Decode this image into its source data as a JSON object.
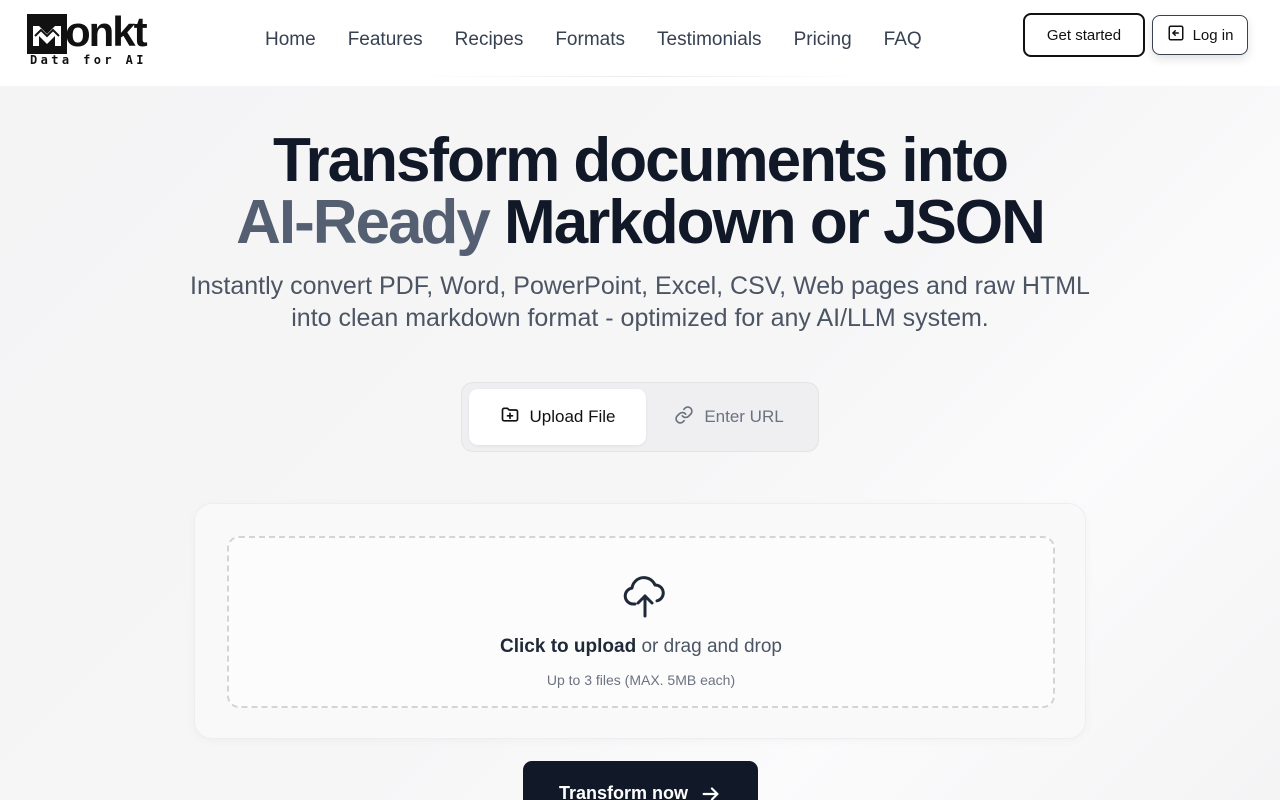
{
  "brand": {
    "name": "Monkt",
    "wordmark": "onkt",
    "tagline": "Data for AI"
  },
  "nav": {
    "items": [
      {
        "label": "Home"
      },
      {
        "label": "Features"
      },
      {
        "label": "Recipes"
      },
      {
        "label": "Formats"
      },
      {
        "label": "Testimonials"
      },
      {
        "label": "Pricing"
      },
      {
        "label": "FAQ"
      }
    ]
  },
  "header": {
    "get_started_label": "Get started",
    "login_label": "Log in"
  },
  "hero": {
    "title_line1": "Transform documents into",
    "title_accent": "AI-Ready",
    "title_line2_rest": "Markdown or JSON",
    "subtitle_line1": "Instantly convert PDF, Word, PowerPoint, Excel, CSV, Web pages and raw HTML",
    "subtitle_line2": "into clean markdown format - optimized for any AI/LLM system."
  },
  "tabs": [
    {
      "label": "Upload File",
      "icon": "folder-plus-icon",
      "active": true
    },
    {
      "label": "Enter URL",
      "icon": "link-icon",
      "active": false
    }
  ],
  "upload": {
    "icon": "cloud-upload-icon",
    "click_text": "Click to upload",
    "drag_text": "or drag and drop",
    "hint": "Up to 3 files (MAX. 5MB each)"
  },
  "cta": {
    "label": "Transform now",
    "icon": "arrow-right-icon"
  },
  "colors": {
    "primary": "#111827",
    "accent_text": "#555f72",
    "muted_text": "#4b5563"
  }
}
